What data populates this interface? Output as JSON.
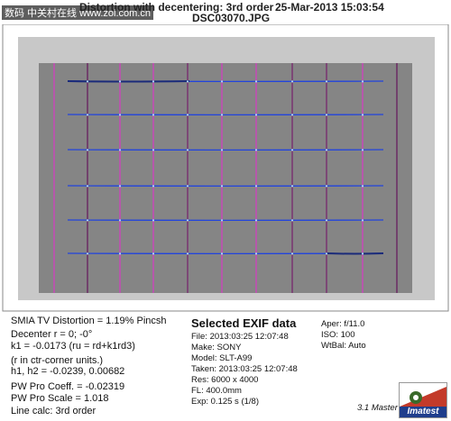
{
  "header": {
    "watermark": "数码 中关村在线 www.zol.com.cn",
    "title": "Distortion with decentering:  3rd order",
    "date": "25-Mar-2013 15:03:54",
    "filename": "DSC03070.JPG"
  },
  "left_panel": {
    "distortion": "SMIA TV Distortion = 1.19% Pincsh",
    "decenter": "Decenter r = 0;  -0°",
    "k1": "k1 = -0.0173  (ru = rd+k1rd3)",
    "ctr_units": "(r in ctr-corner units.)",
    "h1h2": "h1, h2 = -0.0239, 0.00682",
    "pw_coeff": "PW Pro Coeff. = -0.02319",
    "pw_scale": "PW Pro Scale = 1.018",
    "line_calc": "Line calc: 3rd order"
  },
  "exif": {
    "title": "Selected EXIF data",
    "file": "File:  2013:03:25 12:07:48",
    "make": "Make:  SONY",
    "model": "Model:  SLT-A99",
    "taken": "Taken:  2013:03:25 12:07:48",
    "res": "Res:     6000 x 4000",
    "fl": "FL:   400.0mm",
    "exp": "Exp:   0.125 s  (1/8)"
  },
  "right_panel": {
    "aper": "Aper:  f/11.0",
    "iso": "ISO:    100",
    "wtbal": "WtBal:  Auto",
    "version": "3.1  Master",
    "logo": "Imatest"
  },
  "colors": {
    "grid_line": "#2244dd",
    "vertical_line": "#d040c0",
    "dark_line": "#1a1a1a",
    "target_bg": "#858585",
    "border_bg": "#c8c8c8"
  }
}
